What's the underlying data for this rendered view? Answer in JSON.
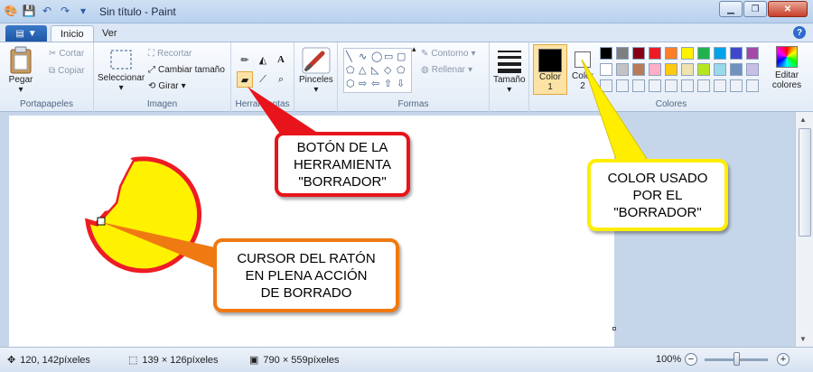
{
  "window": {
    "title": "Sin título - Paint"
  },
  "tabs": {
    "menu_glyph": "▼",
    "home": "Inicio",
    "view": "Ver",
    "help": "?"
  },
  "ribbon": {
    "clipboard": {
      "paste": "Pegar",
      "cut": "Cortar",
      "copy": "Copiar",
      "group": "Portapapeles"
    },
    "image": {
      "select": "Seleccionar",
      "crop": "Recortar",
      "resize": "Cambiar tamaño",
      "rotate": "Girar",
      "group": "Imagen"
    },
    "tools": {
      "group": "Herramientas",
      "selected_tool": "eraser"
    },
    "brushes": {
      "label": "Pinceles"
    },
    "shapes": {
      "outline": "Contorno",
      "fill": "Rellenar",
      "group": "Formas"
    },
    "size": {
      "label": "Tamaño"
    },
    "colors": {
      "color1": {
        "line1": "Color",
        "line2": "1",
        "value": "#000000"
      },
      "color2": {
        "line1": "Color",
        "line2": "2",
        "value": "#ffffff"
      },
      "edit": {
        "line1": "Editar",
        "line2": "colores"
      },
      "group": "Colores",
      "palette_row1": [
        "#000000",
        "#7f7f7f",
        "#880015",
        "#ed1c24",
        "#ff7f27",
        "#fff200",
        "#22b14c",
        "#00a2e8",
        "#3f48cc",
        "#a349a4"
      ],
      "palette_row2": [
        "#ffffff",
        "#c3c3c3",
        "#b97a57",
        "#ffaec9",
        "#ffc90e",
        "#efe4b0",
        "#b5e61d",
        "#99d9ea",
        "#7092be",
        "#c8bfe7"
      ]
    }
  },
  "callouts": {
    "eraser_button": {
      "line1": "BOTÓN DE LA",
      "line2": "HERRAMIENTA",
      "line3": "\"BORRADOR\"",
      "color": "#e8141b"
    },
    "eraser_color": {
      "line1": "COLOR USADO",
      "line2": "POR EL",
      "line3": "\"BORRADOR\"",
      "color": "#ffee00"
    },
    "cursor": {
      "line1": "CURSOR DEL RATÓN",
      "line2": "EN PLENA ACCIÓN",
      "line3": "DE BORRADO",
      "color": "#f07a12"
    }
  },
  "status": {
    "cursor_pos": "120, 142píxeles",
    "selection_size": "139 × 126píxeles",
    "image_size": "790 × 559píxeles",
    "zoom": "100%",
    "zoom_level_percent": 100
  }
}
